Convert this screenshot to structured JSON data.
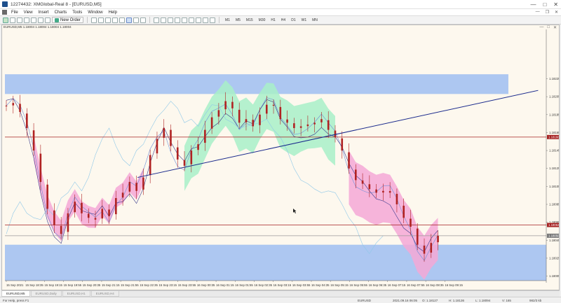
{
  "window": {
    "title": "12274432: XMGlobal-Real 8 - [EURUSD,M5]",
    "buttons": [
      "—",
      "□",
      "✕"
    ]
  },
  "menu": {
    "items": [
      "File",
      "View",
      "Insert",
      "Charts",
      "Tools",
      "Window",
      "Help"
    ],
    "mdi_buttons": [
      "—",
      "❐",
      "✕"
    ]
  },
  "toolbar": {
    "new_order": "New Order",
    "timeframes": [
      "M1",
      "M5",
      "M15",
      "M30",
      "H1",
      "H4",
      "D1",
      "W1",
      "MN"
    ]
  },
  "chart_window": {
    "header": "EURUSD,M5  1.18004 1.18004 1.18004 1.18004",
    "controls": [
      "—",
      "□",
      "✕"
    ]
  },
  "tabs": [
    "EURUSD,M5",
    "EURUSD,Daily",
    "EURUSD,H1",
    "EURUSD,H4"
  ],
  "status": {
    "help": "For Help, press F1",
    "symbol": "EURUSD",
    "time": "2021.09.16 06:05",
    "open": "O: 1.18127",
    "high": "H: 1.18136",
    "low": "L: 1.18094",
    "volume": "V: 165",
    "traffic": "982/3 kb"
  },
  "colors": {
    "background": "#fdf8ee",
    "zone": "#a9c4f0",
    "cloud_bull": "#a8f0c8",
    "cloud_bear": "#f5a8d6",
    "candle": "#b02222",
    "tenkan": "#7090d8",
    "chikou": "#8fc8e8",
    "trendline": "#1a2a8c",
    "hline": "#a52020"
  },
  "chart_data": {
    "type": "candlestick",
    "symbol": "EURUSD",
    "timeframe": "M5",
    "ylim": [
      1.18,
      1.1828
    ],
    "y_ticks": [
      "1.18225",
      "1.18205",
      "1.18185",
      "1.18165",
      "1.18145",
      "1.18125",
      "1.18105",
      "1.18085",
      "1.18065",
      "1.18045",
      "1.18025",
      "1.18005"
    ],
    "x_ticks": [
      "15 Sep 2021",
      "15 Sep 18:35",
      "15 Sep 19:15",
      "15 Sep 19:55",
      "15 Sep 20:35",
      "15 Sep 21:15",
      "15 Sep 21:55",
      "15 Sep 22:35",
      "15 Sep 23:15",
      "15 Sep 23:55",
      "16 Sep 00:35",
      "16 Sep 01:15",
      "16 Sep 01:55",
      "16 Sep 02:35",
      "16 Sep 03:15",
      "16 Sep 03:55",
      "16 Sep 04:35",
      "16 Sep 05:15",
      "16 Sep 05:55",
      "16 Sep 06:35",
      "16 Sep 07:15",
      "16 Sep 07:55",
      "16 Sep 08:35",
      "16 Sep 09:15"
    ],
    "price_labels": [
      {
        "price": 1.1816,
        "label": "1.18160",
        "color": "#a52020"
      },
      {
        "price": 1.18062,
        "label": "1.18062",
        "color": "#a52020"
      },
      {
        "price": 1.1805,
        "label": "1.18050",
        "color": "#777777"
      }
    ],
    "zones": [
      {
        "from": 1.1823,
        "to": 1.18208,
        "color": "#a9c4f0",
        "x_end_frac": 0.93
      },
      {
        "from": 1.1804,
        "to": 1.18,
        "color": "#a9c4f0",
        "x_end_frac": 1.0
      }
    ],
    "hlines": [
      {
        "price": 1.1816,
        "color": "#a52020"
      },
      {
        "price": 1.18062,
        "color": "#a52020"
      },
      {
        "price": 1.1805,
        "color": "#999999"
      }
    ],
    "trendline": {
      "x_frac": [
        0.245,
        0.985
      ],
      "price": [
        1.18115,
        1.18212
      ]
    },
    "series_close_path": [
      1.18195,
      1.18198,
      1.18188,
      1.1817,
      1.18145,
      1.1811,
      1.1808,
      1.18062,
      1.18052,
      1.18075,
      1.18088,
      1.18075,
      1.1807,
      1.18068,
      1.1808,
      1.18072,
      1.18092,
      1.18098,
      1.1811,
      1.181,
      1.18115,
      1.1814,
      1.18158,
      1.1817,
      1.1815,
      1.18135,
      1.18128,
      1.18145,
      1.18152,
      1.18168,
      1.18182,
      1.1819,
      1.182,
      1.18192,
      1.18176,
      1.1818,
      1.18172,
      1.18185,
      1.18196,
      1.18195,
      1.1818,
      1.18176,
      1.1817,
      1.18172,
      1.18174,
      1.18176,
      1.1818,
      1.18168,
      1.1816,
      1.18145,
      1.18125,
      1.18112,
      1.18108,
      1.18102,
      1.18098,
      1.181,
      1.18098,
      1.18085,
      1.1807,
      1.1806,
      1.1804,
      1.1803,
      1.18042,
      1.1805
    ]
  }
}
